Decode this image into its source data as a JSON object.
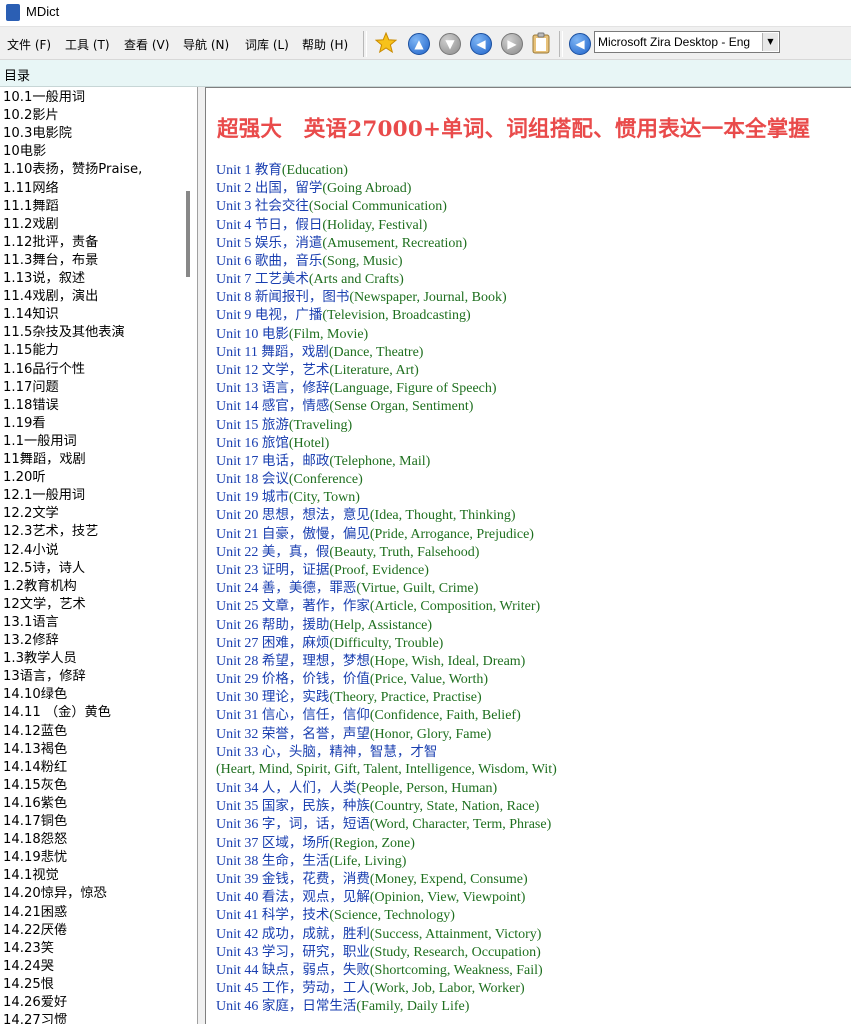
{
  "window": {
    "title": "MDict"
  },
  "menu": [
    {
      "label": "文件 (F)"
    },
    {
      "label": "工具 (T)"
    },
    {
      "label": "查看 (V)"
    },
    {
      "label": "导航 (N)"
    },
    {
      "label": "词库 (L)"
    },
    {
      "label": "帮助 (H)"
    }
  ],
  "toolbar": {
    "buttons": [
      {
        "name": "favorite-star-icon"
      },
      {
        "name": "arrow-up-icon"
      },
      {
        "name": "arrow-down-icon"
      },
      {
        "name": "back-arrow-icon"
      },
      {
        "name": "forward-arrow-icon"
      },
      {
        "name": "clipboard-icon"
      },
      {
        "name": "speaker-back-icon"
      }
    ],
    "voice": "Microsoft Zira Desktop - Eng"
  },
  "address": {
    "label": "目录"
  },
  "sidebar": {
    "items": [
      "10.1一般用词",
      "10.2影片",
      "10.3电影院",
      "10电影",
      "1.10表扬，赞扬Praise,",
      "1.11网络",
      "11.1舞蹈",
      "11.2戏剧",
      "1.12批评，责备",
      "11.3舞台，布景",
      "1.13说，叙述",
      "11.4戏剧，演出",
      "1.14知识",
      "11.5杂技及其他表演",
      "1.15能力",
      "1.16品行个性",
      "1.17问题",
      "1.18错误",
      "1.19看",
      "1.1一般用词",
      "11舞蹈，戏剧",
      "1.20听",
      "12.1一般用词",
      "12.2文学",
      "12.3艺术，技艺",
      "12.4小说",
      "12.5诗，诗人",
      "1.2教育机构",
      "12文学，艺术",
      "13.1语言",
      "13.2修辞",
      "1.3教学人员",
      "13语言，修辞",
      "14.10绿色",
      "14.11 （金）黄色",
      "14.12蓝色",
      "14.13褐色",
      "14.14粉红",
      "14.15灰色",
      "14.16紫色",
      "14.17铜色",
      "14.18怨怒",
      "14.19悲忧",
      "14.1视觉",
      "14.20惊异，惊恐",
      "14.21困惑",
      "14.22厌倦",
      "14.23笑",
      "14.24哭",
      "14.25恨",
      "14.26爱好",
      "14.27习惯"
    ]
  },
  "content": {
    "headline": "超强大　英语27000+单词、词组搭配、惯用表达一本全掌握",
    "units": [
      {
        "num": "Unit 1",
        "zh": "教育",
        "en": "(Education)"
      },
      {
        "num": "Unit 2",
        "zh": "出国，留学",
        "en": "(Going Abroad)"
      },
      {
        "num": "Unit 3",
        "zh": "社会交往",
        "en": "(Social Communication)"
      },
      {
        "num": "Unit 4",
        "zh": "节日，假日",
        "en": "(Holiday, Festival)"
      },
      {
        "num": "Unit 5",
        "zh": "娱乐，消遣",
        "en": "(Amusement, Recreation)"
      },
      {
        "num": "Unit 6",
        "zh": "歌曲，音乐",
        "en": "(Song, Music)"
      },
      {
        "num": "Unit 7",
        "zh": "工艺美术",
        "en": "(Arts and Crafts)"
      },
      {
        "num": "Unit 8",
        "zh": "新闻报刊，图书",
        "en": "(Newspaper, Journal, Book)"
      },
      {
        "num": "Unit 9",
        "zh": "电视，广播",
        "en": "(Television, Broadcasting)"
      },
      {
        "num": "Unit 10",
        "zh": "电影",
        "en": "(Film, Movie)"
      },
      {
        "num": "Unit 11",
        "zh": "舞蹈，戏剧",
        "en": "(Dance, Theatre)"
      },
      {
        "num": "Unit 12",
        "zh": "文学，艺术",
        "en": "(Literature, Art)"
      },
      {
        "num": "Unit 13",
        "zh": "语言，修辞",
        "en": "(Language, Figure of Speech)"
      },
      {
        "num": "Unit 14",
        "zh": "感官，情感",
        "en": "(Sense Organ, Sentiment)"
      },
      {
        "num": "Unit 15",
        "zh": "旅游",
        "en": "(Traveling)"
      },
      {
        "num": "Unit 16",
        "zh": "旅馆",
        "en": "(Hotel)"
      },
      {
        "num": "Unit 17",
        "zh": "电话，邮政",
        "en": "(Telephone, Mail)"
      },
      {
        "num": "Unit 18",
        "zh": "会议",
        "en": "(Conference)"
      },
      {
        "num": "Unit 19",
        "zh": "城市",
        "en": "(City, Town)"
      },
      {
        "num": "Unit 20",
        "zh": "思想，想法，意见",
        "en": "(Idea, Thought, Thinking)"
      },
      {
        "num": "Unit 21",
        "zh": "自豪，傲慢，偏见",
        "en": "(Pride, Arrogance, Prejudice)"
      },
      {
        "num": "Unit 22",
        "zh": "美，真，假",
        "en": "(Beauty, Truth, Falsehood)"
      },
      {
        "num": "Unit 23",
        "zh": "证明，证据",
        "en": "(Proof, Evidence)"
      },
      {
        "num": "Unit 24",
        "zh": "善，美德，罪恶",
        "en": "(Virtue, Guilt, Crime)"
      },
      {
        "num": "Unit 25",
        "zh": "文章，著作，作家",
        "en": "(Article, Composition, Writer)"
      },
      {
        "num": "Unit 26",
        "zh": "帮助，援助",
        "en": "(Help, Assistance)"
      },
      {
        "num": "Unit 27",
        "zh": "困难，麻烦",
        "en": "(Difficulty, Trouble)"
      },
      {
        "num": "Unit 28",
        "zh": "希望，理想，梦想",
        "en": "(Hope, Wish, Ideal, Dream)"
      },
      {
        "num": "Unit 29",
        "zh": "价格，价钱，价值",
        "en": "(Price, Value, Worth)"
      },
      {
        "num": "Unit 30",
        "zh": "理论，实践",
        "en": "(Theory, Practice, Practise)"
      },
      {
        "num": "Unit 31",
        "zh": "信心，信任，信仰",
        "en": "(Confidence, Faith, Belief)"
      },
      {
        "num": "Unit 32",
        "zh": "荣誉，名誉，声望",
        "en": "(Honor, Glory, Fame)"
      },
      {
        "num": "Unit 33",
        "zh": "心，头脑，精神，智慧，才智",
        "en": ""
      },
      {
        "num": "",
        "zh": "",
        "en": "(Heart, Mind, Spirit, Gift, Talent, Intelligence, Wisdom, Wit)"
      },
      {
        "num": "Unit 34",
        "zh": "人，人们，人类",
        "en": "(People, Person, Human)"
      },
      {
        "num": "Unit 35",
        "zh": "国家，民族，种族",
        "en": "(Country, State, Nation, Race)"
      },
      {
        "num": "Unit 36",
        "zh": "字，词，话，短语",
        "en": "(Word, Character, Term, Phrase)"
      },
      {
        "num": "Unit 37",
        "zh": "区域，场所",
        "en": "(Region, Zone)"
      },
      {
        "num": "Unit 38",
        "zh": "生命，生活",
        "en": "(Life, Living)"
      },
      {
        "num": "Unit 39",
        "zh": "金钱，花费，消费",
        "en": "(Money, Expend, Consume)"
      },
      {
        "num": "Unit 40",
        "zh": "看法，观点，见解",
        "en": "(Opinion, View, Viewpoint)"
      },
      {
        "num": "Unit 41",
        "zh": "科学，技术",
        "en": "(Science, Technology)"
      },
      {
        "num": "Unit 42",
        "zh": "成功，成就，胜利",
        "en": "(Success, Attainment, Victory)"
      },
      {
        "num": "Unit 43",
        "zh": "学习，研究，职业",
        "en": "(Study, Research, Occupation)"
      },
      {
        "num": "Unit 44",
        "zh": "缺点，弱点，失败",
        "en": "(Shortcoming, Weakness, Fail)"
      },
      {
        "num": "Unit 45",
        "zh": "工作，劳动，工人",
        "en": "(Work, Job, Labor, Worker)"
      },
      {
        "num": "Unit 46",
        "zh": "家庭，日常生活",
        "en": "(Family, Daily Life)"
      }
    ]
  }
}
